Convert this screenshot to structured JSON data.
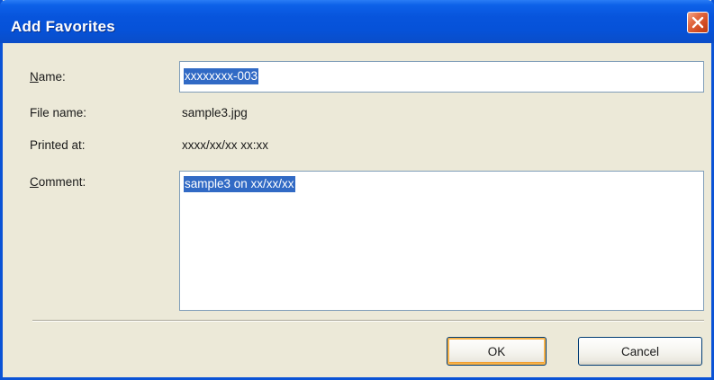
{
  "dialog": {
    "title": "Add Favorites"
  },
  "form": {
    "name_label_accel": "N",
    "name_label_rest": "ame:",
    "name_value": "xxxxxxxx-003",
    "file_name_label": "File name:",
    "file_name_value": "sample3.jpg",
    "printed_at_label": "Printed at:",
    "printed_at_value": "xxxx/xx/xx xx:xx",
    "comment_label_accel": "C",
    "comment_label_rest": "omment:",
    "comment_value": "sample3 on xx/xx/xx"
  },
  "buttons": {
    "ok_label": "OK",
    "cancel_label": "Cancel"
  },
  "icons": {
    "close": "close-icon"
  },
  "colors": {
    "titlebar": "#0754dc",
    "selection": "#316ac5",
    "dialog_bg": "#ece9d8",
    "close_button": "#d14b22",
    "default_button_highlight": "#f8b34a"
  }
}
